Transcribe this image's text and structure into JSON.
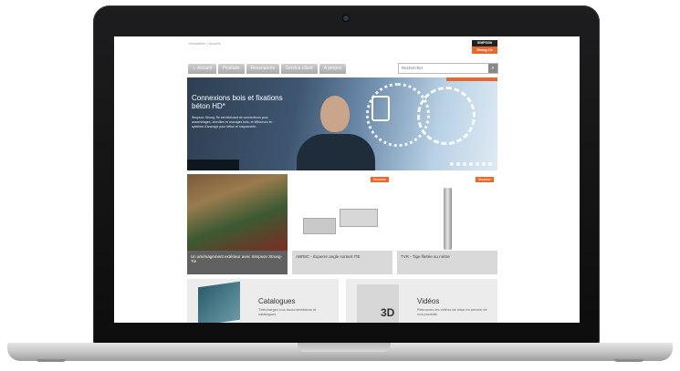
{
  "breadcrumb": "Immobilier | Accueil",
  "brand": {
    "line1": "SIMPSON",
    "line2": "Strong-Tie",
    "accent": "#e9692c"
  },
  "nav": {
    "tabs": [
      "Accueil",
      "Produits",
      "Ressources",
      "Service client",
      "A propos"
    ],
    "search_placeholder": "Rechercher",
    "search_icon": "magnifier-icon"
  },
  "hero": {
    "title": "Connexions bois et fixations béton HD*",
    "text": "Simpson Strong-Tie est fabricant de connecteurs pour assemblages, chevilles et ancrages bois, et diffuseurs en système d'ancrage pour béton et maçonnerie."
  },
  "products": [
    {
      "caption": "Un aménagement extérieur avec Simpson Strong-Tie",
      "badge": ""
    },
    {
      "caption": "ABR8C - Équerre angle sortant ITE",
      "badge": "Nouveau"
    },
    {
      "caption": "TVR - Tige filetée au mètre",
      "badge": "Nouveau"
    }
  ],
  "tiles": [
    {
      "title": "Catalogues",
      "desc": "Téléchargez nos documentations et catalogues"
    },
    {
      "title": "Vidéos",
      "desc": "Retrouvez les vidéos de mise en oeuvre de nos produits",
      "badge3d": "3D"
    }
  ]
}
